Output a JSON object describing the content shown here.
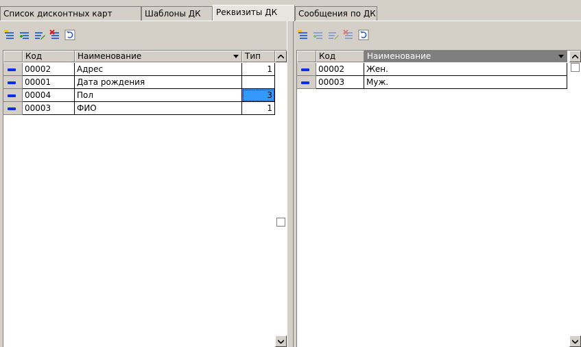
{
  "tabs": [
    {
      "label": "Список дисконтных карт",
      "active": false
    },
    {
      "label": "Шаблоны ДК",
      "active": false
    },
    {
      "label": "Реквизиты ДК",
      "active": true
    },
    {
      "label": "Сообщения по ДК",
      "active": false
    }
  ],
  "left": {
    "toolbar": [
      "add-row-icon",
      "add-child-icon",
      "edit-icon",
      "delete-icon",
      "refresh-icon"
    ],
    "columns": {
      "code": "Код",
      "name": "Наименование",
      "type": "Тип"
    },
    "rows": [
      {
        "code": "00002",
        "name": "Адрес",
        "type": "1"
      },
      {
        "code": "00001",
        "name": "Дата рождения",
        "type": ""
      },
      {
        "code": "00004",
        "name": "Пол",
        "type": "3"
      },
      {
        "code": "00003",
        "name": "ФИО",
        "type": "1"
      }
    ]
  },
  "right": {
    "toolbar": [
      "add-row-icon",
      "add-child-icon",
      "edit-icon",
      "delete-icon",
      "refresh-icon"
    ],
    "columns": {
      "code": "Код",
      "name": "Наименование"
    },
    "rows": [
      {
        "code": "00002",
        "name": "Жен."
      },
      {
        "code": "00003",
        "name": "Муж."
      }
    ]
  },
  "colors": {
    "window": "#d4d0c8",
    "selection": "#3399ff",
    "indicator": "#0a2ee8",
    "header_selected": "#7f7f7f"
  }
}
